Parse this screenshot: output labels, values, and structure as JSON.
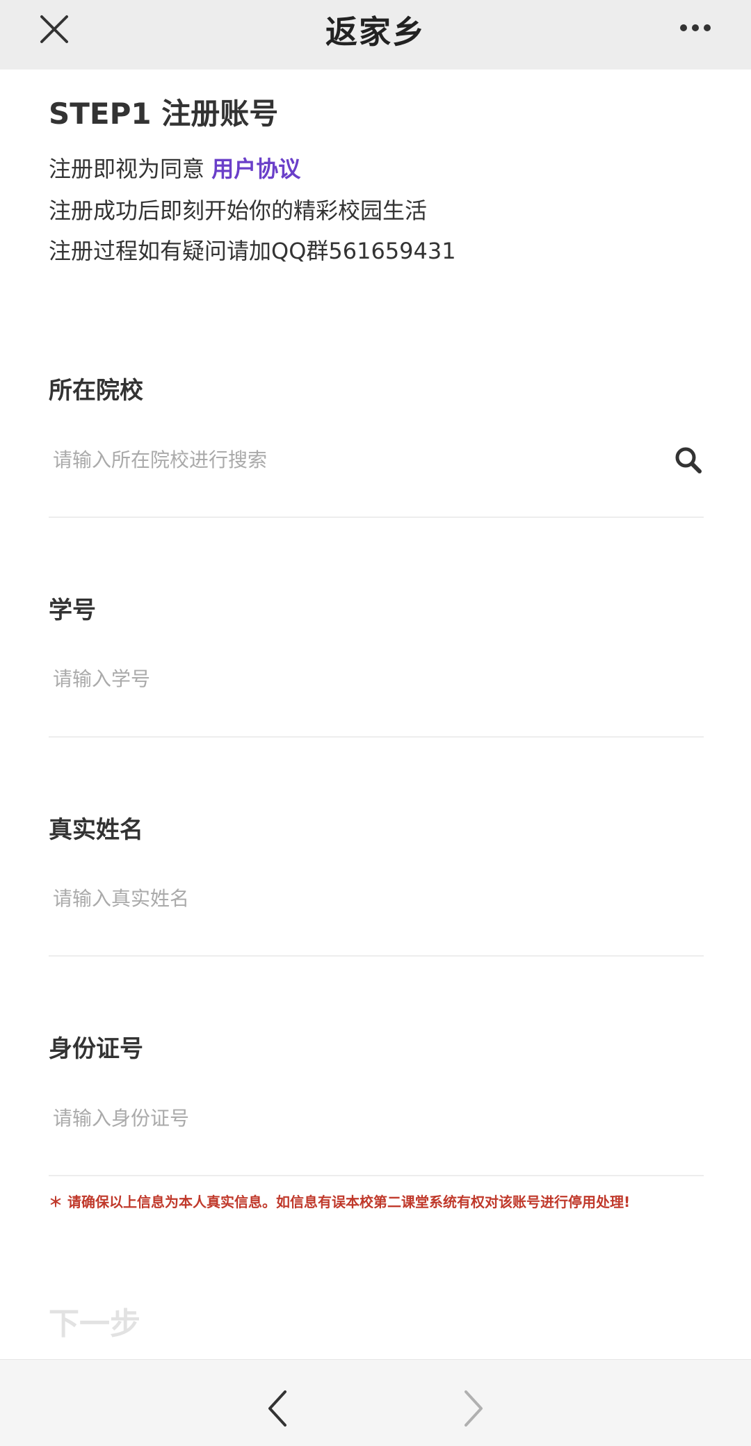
{
  "header": {
    "title": "返家乡"
  },
  "intro": {
    "step_title": "STEP1 注册账号",
    "agree_prefix": "注册即视为同意 ",
    "agreement_link": "用户协议",
    "line2": "注册成功后即刻开始你的精彩校园生活",
    "line3": "注册过程如有疑问请加QQ群561659431"
  },
  "fields": {
    "school": {
      "label": "所在院校",
      "placeholder": "请输入所在院校进行搜索",
      "value": ""
    },
    "student_id": {
      "label": "学号",
      "placeholder": "请输入学号",
      "value": ""
    },
    "real_name": {
      "label": "真实姓名",
      "placeholder": "请输入真实姓名",
      "value": ""
    },
    "id_number": {
      "label": "身份证号",
      "placeholder": "请输入身份证号",
      "value": ""
    }
  },
  "notice": "＊ 请确保以上信息为本人真实信息。如信息有误本校第二课堂系统有权对该账号进行停用处理!",
  "next_button": "下一步",
  "icons": {
    "close": "close-icon",
    "more": "more-dots-icon",
    "search": "search-icon",
    "back": "chevron-left-icon",
    "forward": "chevron-right-icon"
  },
  "colors": {
    "link": "#6a3fc9",
    "notice": "#c0392b",
    "placeholder": "#aaaaaa",
    "next_disabled": "#e2e2e2",
    "header_bg": "#ededed",
    "footer_bg": "#f5f5f5"
  }
}
